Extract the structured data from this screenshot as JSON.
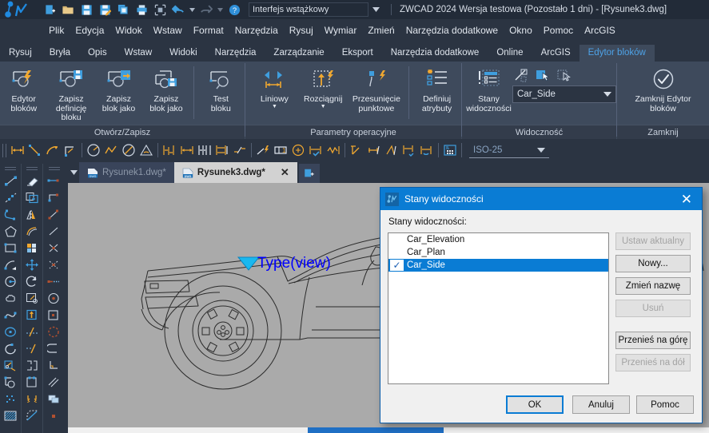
{
  "titlebar": {
    "app_title": "ZWCAD 2024 Wersja testowa (Pozostało 1 dni) - [Rysunek3.dwg]",
    "interface_combo": "Interfejs wstążkowy",
    "quick_access": [
      {
        "name": "new-icon",
        "label": "Nowy"
      },
      {
        "name": "open-folder-icon",
        "label": "Otwórz"
      },
      {
        "name": "save-icon",
        "label": "Zapisz"
      },
      {
        "name": "save-as-icon",
        "label": "Zapisz jako"
      },
      {
        "name": "copy-icon",
        "label": "Kopiuj"
      },
      {
        "name": "print-icon",
        "label": "Drukuj"
      },
      {
        "name": "plot-preview-icon",
        "label": "Podgląd wydruku"
      },
      {
        "name": "undo-icon",
        "label": "Cofnij"
      },
      {
        "name": "redo-icon",
        "label": "Ponów"
      },
      {
        "name": "help-icon",
        "label": "Pomoc"
      }
    ]
  },
  "menubar": {
    "items": [
      {
        "label": "Plik"
      },
      {
        "label": "Edycja"
      },
      {
        "label": "Widok"
      },
      {
        "label": "Wstaw"
      },
      {
        "label": "Format"
      },
      {
        "label": "Narzędzia"
      },
      {
        "label": "Rysuj"
      },
      {
        "label": "Wymiar"
      },
      {
        "label": "Zmień"
      },
      {
        "label": "Narzędzia dodatkowe"
      },
      {
        "label": "Okno"
      },
      {
        "label": "Pomoc"
      },
      {
        "label": "ArcGIS"
      }
    ]
  },
  "ribbon_tabs": {
    "items": [
      {
        "label": "Rysuj",
        "active": false
      },
      {
        "label": "Bryła",
        "active": false
      },
      {
        "label": "Opis",
        "active": false
      },
      {
        "label": "Wstaw",
        "active": false
      },
      {
        "label": "Widoki",
        "active": false
      },
      {
        "label": "Narzędzia",
        "active": false
      },
      {
        "label": "Zarządzanie",
        "active": false
      },
      {
        "label": "Eksport",
        "active": false
      },
      {
        "label": "Narzędzia dodatkowe",
        "active": false
      },
      {
        "label": "Online",
        "active": false
      },
      {
        "label": "ArcGIS",
        "active": false
      },
      {
        "label": "Edytor bloków",
        "active": true
      }
    ]
  },
  "ribbon": {
    "groups": [
      {
        "title": "Otwórz/Zapisz",
        "buttons": [
          {
            "name": "block-editor-button",
            "label": "Edytor\nbloków",
            "icon": "block-editor-icon"
          },
          {
            "name": "save-block-definition-button",
            "label": "Zapisz\ndefinicję bloku",
            "icon": "save-block-icon"
          },
          {
            "name": "save-block-as-button",
            "label": "Zapisz\nblok jako",
            "icon": "save-block-as-icon"
          },
          {
            "name": "save-block-copy-button",
            "label": "Zapisz\nblok jako",
            "icon": "save-block-copy-icon"
          },
          {
            "name": "test-block-button",
            "label": "Test\nbloku",
            "icon": "test-block-icon"
          }
        ]
      },
      {
        "title": "Parametry operacyjne",
        "buttons": [
          {
            "name": "linear-button",
            "label": "Liniowy",
            "icon": "linear-parameter-icon",
            "caret": true
          },
          {
            "name": "stretch-button",
            "label": "Rozciągnij",
            "icon": "stretch-action-icon",
            "caret": true
          },
          {
            "name": "point-move-button",
            "label": "Przesunięcie\npunktowe",
            "icon": "point-move-icon",
            "caret": true
          },
          {
            "name": "define-attributes-button",
            "label": "Definiuj\natrybuty",
            "icon": "define-attributes-icon"
          }
        ]
      },
      {
        "title": "Widoczność",
        "buttons": [
          {
            "name": "visibility-states-button",
            "label": "Stany\nwidoczności",
            "icon": "visibility-states-icon"
          }
        ],
        "small_icons": [
          {
            "name": "make-invisible-icon"
          },
          {
            "name": "make-visible-icon"
          },
          {
            "name": "visibility-mode-icon"
          }
        ],
        "combo_value": "Car_Side"
      },
      {
        "title": "Zamknij",
        "buttons": [
          {
            "name": "close-block-editor-button",
            "label": "Zamknij Edytor\nbloków",
            "icon": "close-block-editor-icon"
          }
        ]
      }
    ]
  },
  "toolbar2": {
    "dimstyle_combo": "ISO-25",
    "icons": [
      {
        "name": "dim-linear-icon"
      },
      {
        "name": "dim-aligned-icon"
      },
      {
        "name": "dim-arc-icon"
      },
      {
        "name": "dim-ordinate-icon"
      },
      {
        "name": "dim-radius-icon"
      },
      {
        "name": "dim-jogged-icon"
      },
      {
        "name": "dim-diameter-icon"
      },
      {
        "name": "dim-angular-icon"
      },
      {
        "name": "dim-baseline-icon"
      },
      {
        "name": "dim-continue-icon"
      },
      {
        "name": "dim-quick-icon"
      },
      {
        "name": "dim-space-icon"
      },
      {
        "name": "dim-break-icon"
      },
      {
        "name": "leader-icon"
      },
      {
        "name": "tolerance-icon"
      },
      {
        "name": "center-mark-icon"
      },
      {
        "name": "dim-inspect-icon"
      },
      {
        "name": "dim-jog-line-icon"
      },
      {
        "name": "dim-edit-icon"
      },
      {
        "name": "dim-text-edit-icon"
      },
      {
        "name": "dim-oblique-icon"
      },
      {
        "name": "dim-update-icon"
      },
      {
        "name": "dim-reassociate-icon"
      },
      {
        "name": "dimstyle-manager-icon"
      }
    ]
  },
  "doctabs": {
    "tabs": [
      {
        "name": "doc-tab-rysunek1",
        "label": "Rysunek1.dwg*",
        "active": false
      },
      {
        "name": "doc-tab-rysunek3",
        "label": "Rysunek3.dwg*",
        "active": true
      }
    ],
    "close_glyph": "✕",
    "new_tab_name": "new-document-tab-button"
  },
  "canvas": {
    "annotation_label": "Type(view)",
    "annotation_color": "#0000ff",
    "grip_color": "#00c8ff",
    "background_color": "#aaaaaa"
  },
  "left_toolbar": {
    "columns": [
      {
        "name": "draw-toolbar",
        "icons": [
          {
            "name": "line-icon"
          },
          {
            "name": "construction-line-icon"
          },
          {
            "name": "polyline-icon"
          },
          {
            "name": "polygon-icon"
          },
          {
            "name": "rectangle-icon"
          },
          {
            "name": "arc-icon"
          },
          {
            "name": "circle-icon"
          },
          {
            "name": "revision-cloud-icon"
          },
          {
            "name": "spline-icon"
          },
          {
            "name": "ellipse-icon"
          },
          {
            "name": "ellipse-arc-icon"
          },
          {
            "name": "insert-block-icon"
          },
          {
            "name": "make-block-icon"
          },
          {
            "name": "point-icon"
          },
          {
            "name": "hatch-icon"
          }
        ]
      },
      {
        "name": "modify-toolbar",
        "icons": [
          {
            "name": "erase-icon"
          },
          {
            "name": "copy-icon"
          },
          {
            "name": "mirror-icon"
          },
          {
            "name": "offset-icon"
          },
          {
            "name": "array-icon"
          },
          {
            "name": "move-icon"
          },
          {
            "name": "rotate-icon"
          },
          {
            "name": "scale-icon"
          },
          {
            "name": "stretch-icon"
          },
          {
            "name": "trim-icon"
          },
          {
            "name": "extend-icon"
          },
          {
            "name": "break-at-point-icon"
          },
          {
            "name": "break-icon"
          },
          {
            "name": "join-icon"
          },
          {
            "name": "chamfer-icon"
          }
        ]
      },
      {
        "name": "osnap-toolbar",
        "icons": [
          {
            "name": "snap-endpoint-icon"
          },
          {
            "name": "snap-midpoint-icon"
          },
          {
            "name": "snap-nearest-icon"
          },
          {
            "name": "snap-from-icon"
          },
          {
            "name": "snap-intersection-icon"
          },
          {
            "name": "snap-apparent-icon"
          },
          {
            "name": "snap-extension-icon"
          },
          {
            "name": "snap-center-icon"
          },
          {
            "name": "snap-insert-icon"
          },
          {
            "name": "snap-quadrant-icon"
          },
          {
            "name": "snap-tangent-icon"
          },
          {
            "name": "snap-perpendicular-icon"
          },
          {
            "name": "snap-parallel-icon"
          },
          {
            "name": "snap-node-icon"
          },
          {
            "name": "snap-none-icon"
          }
        ]
      }
    ]
  },
  "dialog": {
    "title": "Stany widoczności",
    "close_glyph": "✕",
    "list_label": "Stany widoczności:",
    "list_items": [
      {
        "label": "Car_Elevation",
        "checked": false,
        "selected": false
      },
      {
        "label": "Car_Plan",
        "checked": false,
        "selected": false
      },
      {
        "label": "Car_Side",
        "checked": true,
        "selected": true
      }
    ],
    "check_glyph": "✓",
    "side_buttons": [
      {
        "name": "set-current-button",
        "label": "Ustaw aktualny",
        "disabled": true
      },
      {
        "name": "new-button",
        "label": "Nowy...",
        "disabled": false
      },
      {
        "name": "rename-button",
        "label": "Zmień nazwę",
        "disabled": false
      },
      {
        "name": "delete-button",
        "label": "Usuń",
        "disabled": true
      },
      {
        "name": "move-up-button",
        "label": "Przenieś na górę",
        "disabled": false
      },
      {
        "name": "move-down-button",
        "label": "Przenieś na dół",
        "disabled": true
      }
    ],
    "bottom_buttons": [
      {
        "name": "ok-button",
        "label": "OK",
        "default": true
      },
      {
        "name": "cancel-button",
        "label": "Anuluj",
        "default": false
      },
      {
        "name": "help-button",
        "label": "Pomoc",
        "default": false
      }
    ]
  },
  "colors": {
    "accent_blue": "#0a7cd4",
    "ribbon_bg": "#3e4a5c",
    "chrome_bg": "#2b3442",
    "titlebar_bg": "#222b38",
    "icon_orange": "#f0a830",
    "icon_blue": "#3f9ede"
  }
}
